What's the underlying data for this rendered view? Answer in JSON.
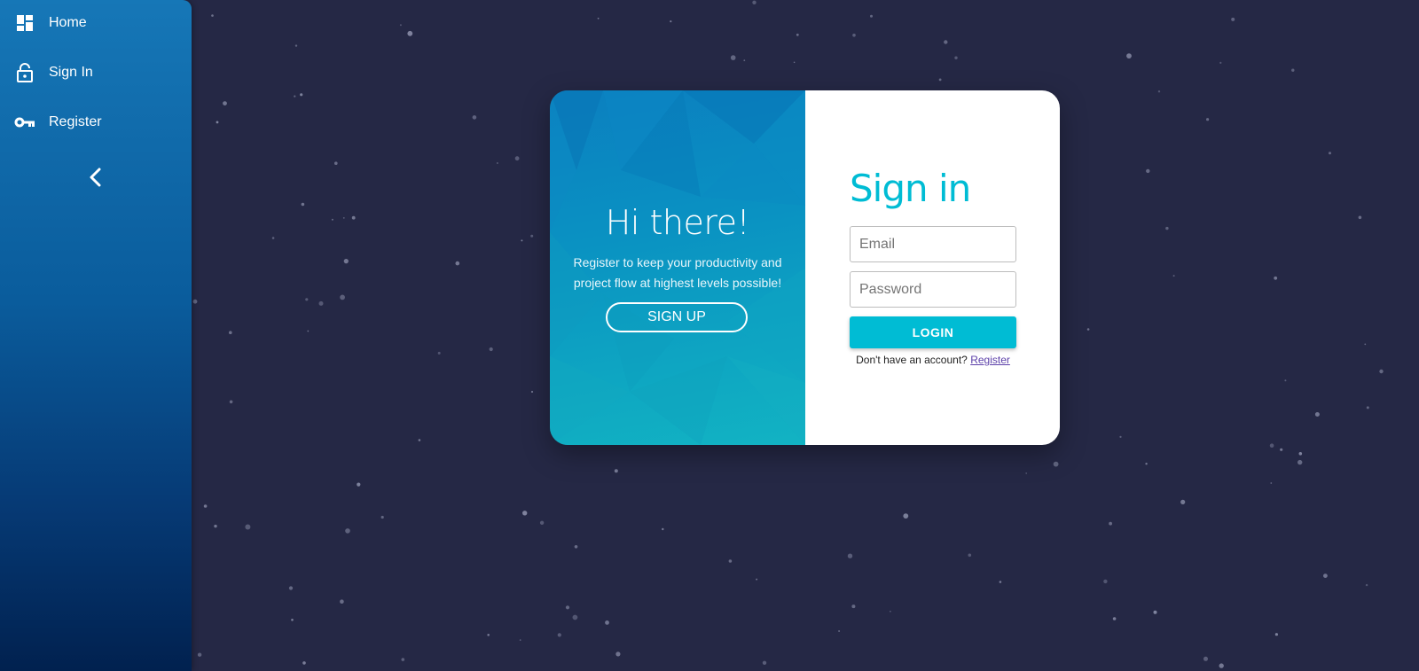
{
  "sidebar": {
    "items": [
      {
        "label": "Home",
        "icon": "dashboard-icon"
      },
      {
        "label": "Sign In",
        "icon": "lock-icon"
      },
      {
        "label": "Register",
        "icon": "key-icon"
      }
    ],
    "collapse_icon": "chevron-left-icon"
  },
  "welcome": {
    "title": "Hi there!",
    "text": "Register to keep your productivity and project flow at highest levels possible!",
    "signup_label": "SIGN UP"
  },
  "signin": {
    "title": "Sign in",
    "email_placeholder": "Email",
    "password_placeholder": "Password",
    "login_label": "LOGIN",
    "account_prompt": "Don't have an account?",
    "register_link": "Register"
  },
  "colors": {
    "background": "#252845",
    "accent": "#00bcd4",
    "sidebar_top": "#1677b7",
    "sidebar_bottom": "#01214f"
  }
}
